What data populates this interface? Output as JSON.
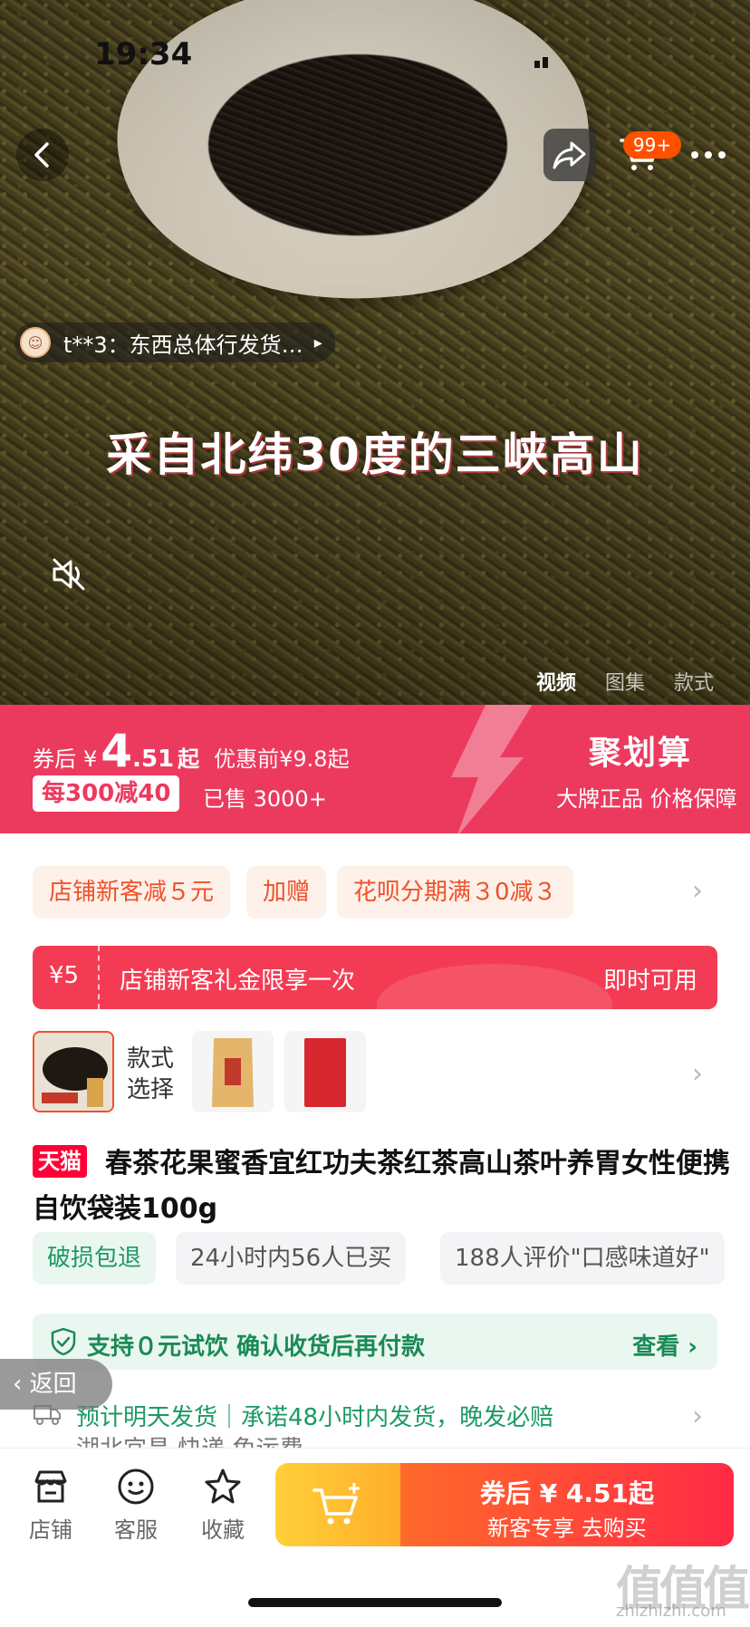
{
  "status_bar": {
    "time": "19:34"
  },
  "header": {
    "cart_badge": "99+"
  },
  "hero": {
    "review_ticker": "t**3：东西总体行发货…",
    "caption": "采自北纬30度的三峡高山",
    "media_tabs": [
      {
        "label": "视频",
        "active": true
      },
      {
        "label": "图集",
        "active": false
      },
      {
        "label": "款式",
        "active": false
      }
    ]
  },
  "price": {
    "prefix": "券后",
    "currency": "¥",
    "integer": "4",
    "decimal": ".51",
    "suffix": "起",
    "original": "优惠前¥9.8起",
    "promo": "每300减40",
    "sold": "已售 3000+",
    "campaign": "聚划算",
    "campaign_sub": "大牌正品 价格保障"
  },
  "coupons": {
    "chips": [
      "店铺新客减５元",
      "加赠",
      "花呗分期满３0减３"
    ],
    "red_coupon": {
      "amount": "¥5",
      "text": "店铺新客礼金限享一次",
      "action": "即时可用"
    }
  },
  "variants": {
    "label": "款式选择",
    "count": 3
  },
  "product": {
    "badge": "天猫",
    "title": "春茶花果蜜香宜红功夫茶红茶高山茶叶养胃女性便携自饮袋装100g"
  },
  "tags": [
    "破损包退",
    "24小时内56人已买",
    "188人评价\"口感味道好\""
  ],
  "guarantee": {
    "text": "支持０元试饮 确认收货后再付款",
    "view": "查看 ›"
  },
  "shipping": {
    "text": "预计明天发货｜承诺48小时内发货，晚发必赔",
    "more": "湖北宜昌 快递 免运费"
  },
  "back_float": "返回",
  "bottom_bar": {
    "store": "店铺",
    "service": "客服",
    "favorite": "收藏",
    "buy_line1": "券后 ¥ 4.51起",
    "buy_line2": "新客专享 去购买"
  },
  "watermark": {
    "mark": "值值值",
    "url": "zhizhizhi.com"
  },
  "colors": {
    "banner": "#ec3a5e",
    "coupon_red": "#f33c54",
    "tag_green": "#1a9a63",
    "buy_gradient_end": "#ff2a45"
  }
}
